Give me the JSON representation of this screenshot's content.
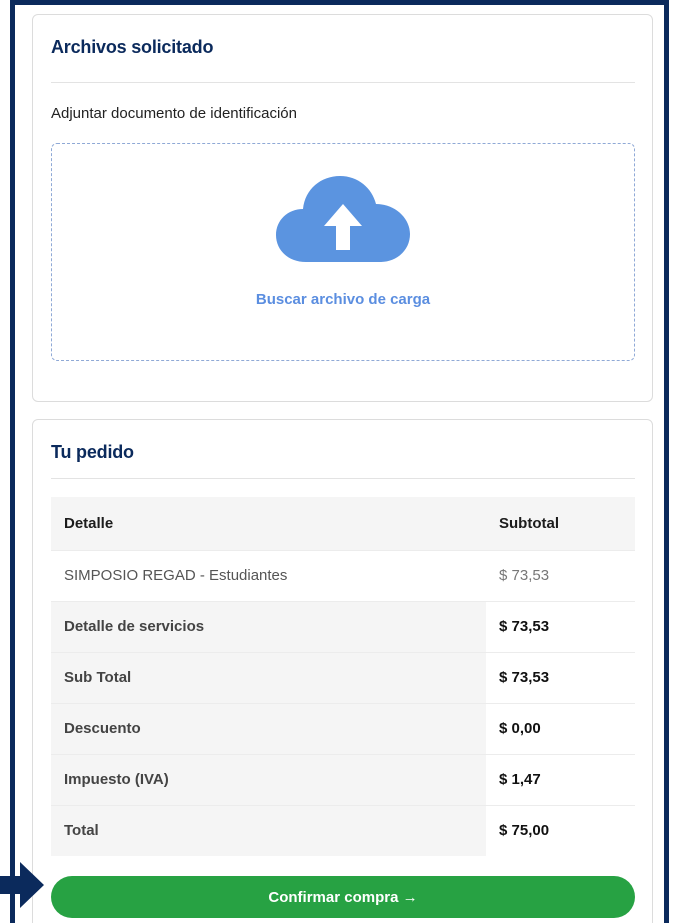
{
  "files_card": {
    "title": "Archivos solicitado",
    "attach_label": "Adjuntar documento de identificación",
    "dropzone_text": "Buscar archivo de carga"
  },
  "order_card": {
    "title": "Tu pedido",
    "headers": {
      "detail": "Detalle",
      "subtotal": "Subtotal"
    },
    "item": {
      "name": "SIMPOSIO REGAD - Estudiantes",
      "price": "$ 73,53"
    },
    "rows": [
      {
        "label": "Detalle de servicios",
        "value": "$ 73,53"
      },
      {
        "label": "Sub Total",
        "value": "$ 73,53"
      },
      {
        "label": "Descuento",
        "value": "$ 0,00"
      },
      {
        "label": "Impuesto (IVA)",
        "value": "$ 1,47"
      },
      {
        "label": "Total",
        "value": "$ 75,00"
      }
    ]
  },
  "confirm_button": "Confirmar compra →",
  "colors": {
    "accent": "#27a243",
    "title": "#0b2a5c",
    "link": "#5b8ee0",
    "cloud": "#5b94e0"
  },
  "icons": {
    "cloud": "cloud-upload-icon",
    "pointer": "arrow-right-indicator-icon"
  }
}
